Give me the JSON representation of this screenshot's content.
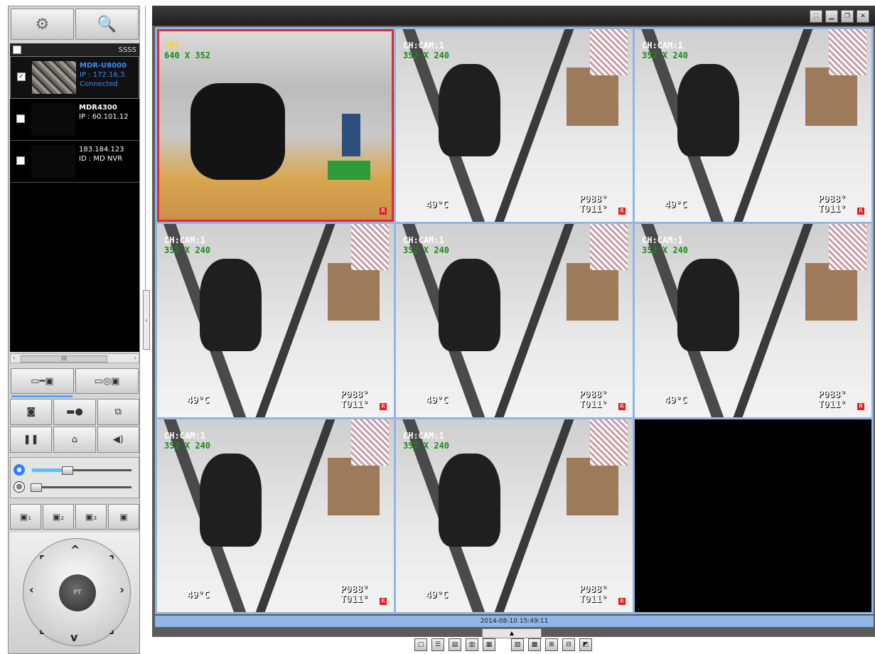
{
  "toolbar": {
    "settings_icon": "⚙",
    "search_icon": "🔍"
  },
  "device_list": {
    "header_icons": "SSSS",
    "devices": [
      {
        "name": "MDR-U8000",
        "ip": "IP : 172.16.3.",
        "status": "Connected",
        "selected": true
      },
      {
        "name": "MDR4300",
        "ip": "IP : 60.101.12",
        "status": "",
        "selected": false
      },
      {
        "name": "183.184.123",
        "ip": "ID : MD NVR",
        "status": "",
        "selected": false
      }
    ],
    "scroll_label": "III"
  },
  "accent_color": "#4aa8ff",
  "ptz": {
    "center_label": "PT"
  },
  "cells": [
    {
      "ch": "CH1",
      "res": "640 X 352",
      "type": "cam1",
      "temp": "",
      "pos1": "",
      "pos2": ""
    },
    {
      "ch": "CH:CAM:1",
      "res": "352 X 240",
      "type": "scene",
      "temp": "49°C",
      "pos1": "P088°",
      "pos2": "T011°"
    },
    {
      "ch": "CH:CAM:1",
      "res": "352 X 240",
      "type": "scene",
      "temp": "49°C",
      "pos1": "P088°",
      "pos2": "T011°"
    },
    {
      "ch": "CH:CAM:1",
      "res": "352 X 240",
      "type": "scene",
      "temp": "49°C",
      "pos1": "P088°",
      "pos2": "T011°"
    },
    {
      "ch": "CH:CAM:1",
      "res": "352 X 240",
      "type": "scene",
      "temp": "49°C",
      "pos1": "P088°",
      "pos2": "T011°"
    },
    {
      "ch": "CH:CAM:1",
      "res": "352 X 240",
      "type": "scene",
      "temp": "49°C",
      "pos1": "P088°",
      "pos2": "T011°"
    },
    {
      "ch": "CH:CAM:1",
      "res": "352 X 240",
      "type": "scene",
      "temp": "49°C",
      "pos1": "P088°",
      "pos2": "T011°"
    },
    {
      "ch": "CH:CAM:1",
      "res": "352 X 240",
      "type": "scene",
      "temp": "49°C",
      "pos1": "P088°",
      "pos2": "T011°"
    },
    {
      "ch": "",
      "res": "",
      "type": "dark",
      "temp": "",
      "pos1": "",
      "pos2": ""
    }
  ],
  "status": {
    "timestamp": "2014-08-10 15:49:11"
  }
}
